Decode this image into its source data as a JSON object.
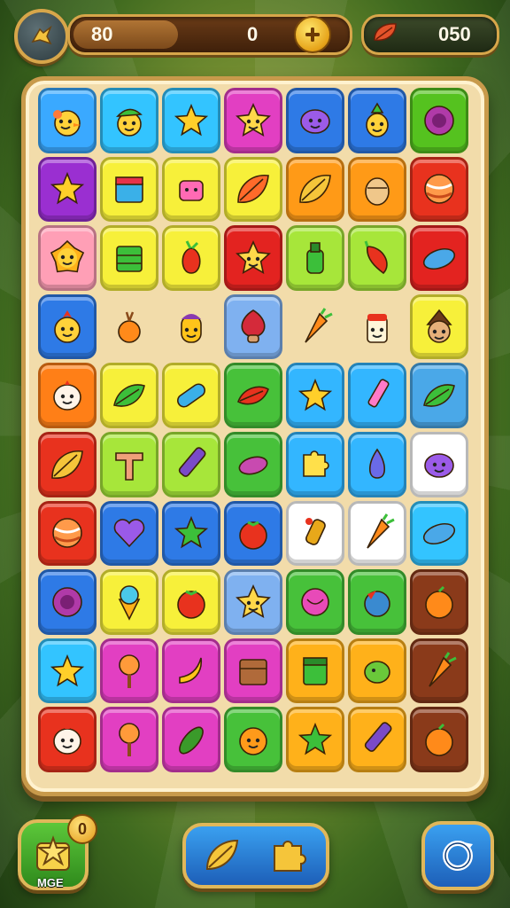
{
  "hud": {
    "moves_value": "80",
    "score_value": "0",
    "leaf_value": "050",
    "colors": {
      "accent_gold": "#d7a64a",
      "bar_brown": "#5a2e0f"
    }
  },
  "board": {
    "tiles": [
      {
        "icon": "chick-icon",
        "color": "#3aa9ff"
      },
      {
        "icon": "leaf-hat-face-icon",
        "color": "#33c4ff"
      },
      {
        "icon": "star-icon",
        "color": "#33c4ff"
      },
      {
        "icon": "smiling-star-icon",
        "color": "#e23fc2"
      },
      {
        "icon": "purple-blob-icon",
        "color": "#2e7ae6"
      },
      {
        "icon": "pineapple-face-icon",
        "color": "#2e7ae6"
      },
      {
        "icon": "purple-flower-icon",
        "color": "#55c21f"
      },
      {
        "icon": "star-icon",
        "color": "#9a2fd1"
      },
      {
        "icon": "gift-box-icon",
        "color": "#f7f03a"
      },
      {
        "icon": "pink-bag-icon",
        "color": "#f7f03a"
      },
      {
        "icon": "leaf-icon",
        "color": "#f7f03a"
      },
      {
        "icon": "gold-leaf-icon",
        "color": "#ff9a17"
      },
      {
        "icon": "acorn-icon",
        "color": "#ff9a17"
      },
      {
        "icon": "orange-ball-icon",
        "color": "#e8321e"
      },
      {
        "icon": "sun-icon",
        "color": "#ff9fb6"
      },
      {
        "icon": "green-block-icon",
        "color": "#f7f03a"
      },
      {
        "icon": "red-fruit-icon",
        "color": "#f7f03a"
      },
      {
        "icon": "smiling-star-icon",
        "color": "#e32320"
      },
      {
        "icon": "green-bottle-icon",
        "color": "#a7e63a"
      },
      {
        "icon": "chili-icon",
        "color": "#a7e63a"
      },
      {
        "icon": "blue-pill-icon",
        "color": "#e32320"
      },
      {
        "icon": "sun-face-icon",
        "color": "#2e7ae6"
      },
      {
        "icon": "onion-icon",
        "color": "#f2dcaa"
      },
      {
        "icon": "corn-face-icon",
        "color": "#f2dcaa"
      },
      {
        "icon": "red-mushroom-icon",
        "color": "#7fb1f0"
      },
      {
        "icon": "carrot-icon",
        "color": "#f2dcaa"
      },
      {
        "icon": "milk-face-icon",
        "color": "#f2dcaa"
      },
      {
        "icon": "acorn-face-icon",
        "color": "#f7f03a"
      },
      {
        "icon": "egg-face-icon",
        "color": "#ff7f17"
      },
      {
        "icon": "green-leaf-icon",
        "color": "#f7f03a"
      },
      {
        "icon": "blue-capsule-icon",
        "color": "#f7f03a"
      },
      {
        "icon": "red-leaf-icon",
        "color": "#47c13a"
      },
      {
        "icon": "star-icon",
        "color": "#33b6ff"
      },
      {
        "icon": "pink-crayon-icon",
        "color": "#33b6ff"
      },
      {
        "icon": "green-leaf-icon",
        "color": "#4aa8e8"
      },
      {
        "icon": "gold-leaf-icon",
        "color": "#e8321e"
      },
      {
        "icon": "letter-t-icon",
        "color": "#a7e63a"
      },
      {
        "icon": "crayon-icon",
        "color": "#a7e63a"
      },
      {
        "icon": "purple-bean-icon",
        "color": "#47c13a"
      },
      {
        "icon": "puzzle-icon",
        "color": "#33b6ff"
      },
      {
        "icon": "blue-drop-icon",
        "color": "#33b6ff"
      },
      {
        "icon": "purple-blob-icon",
        "color": "#ffffff"
      },
      {
        "icon": "orange-ball-icon",
        "color": "#e8321e"
      },
      {
        "icon": "heart-icon",
        "color": "#2e7ae6"
      },
      {
        "icon": "green-star-icon",
        "color": "#2e7ae6"
      },
      {
        "icon": "tomato-icon",
        "color": "#2e7ae6"
      },
      {
        "icon": "sparkler-icon",
        "color": "#ffffff"
      },
      {
        "icon": "carrot-icon",
        "color": "#ffffff"
      },
      {
        "icon": "blue-pill-icon",
        "color": "#33c4ff"
      },
      {
        "icon": "purple-flower-icon",
        "color": "#2e7ae6"
      },
      {
        "icon": "ice-cream-icon",
        "color": "#f7f03a"
      },
      {
        "icon": "tomato-icon",
        "color": "#f7f03a"
      },
      {
        "icon": "smiling-star-icon",
        "color": "#7fb1f0"
      },
      {
        "icon": "pink-ball-icon",
        "color": "#47c13a"
      },
      {
        "icon": "blue-bird-icon",
        "color": "#47c13a"
      },
      {
        "icon": "orange-fruit-icon",
        "color": "#8a3a1a"
      },
      {
        "icon": "star-icon",
        "color": "#33c4ff"
      },
      {
        "icon": "lollipop-icon",
        "color": "#e23fc2"
      },
      {
        "icon": "banana-icon",
        "color": "#e23fc2"
      },
      {
        "icon": "crate-icon",
        "color": "#e23fc2"
      },
      {
        "icon": "green-box-icon",
        "color": "#ffb11a"
      },
      {
        "icon": "green-bean-icon",
        "color": "#ffb11a"
      },
      {
        "icon": "carrot-icon",
        "color": "#8a3a1a"
      },
      {
        "icon": "egg-face-icon",
        "color": "#e8321e"
      },
      {
        "icon": "lollipop-icon",
        "color": "#e23fc2"
      },
      {
        "icon": "cucumber-icon",
        "color": "#e23fc2"
      },
      {
        "icon": "orange-face-icon",
        "color": "#47c13a"
      },
      {
        "icon": "green-star-icon",
        "color": "#ffb11a"
      },
      {
        "icon": "crayon-icon",
        "color": "#ffb11a"
      },
      {
        "icon": "orange-fruit-icon",
        "color": "#8a3a1a"
      }
    ]
  },
  "bottom": {
    "mode_label": "MGE",
    "mode_badge": "0",
    "left_icon": "star-in-box-icon",
    "center_icons": [
      "gold-leaf-icon",
      "puzzle-piece-icon"
    ],
    "right_icon": "refresh-icon"
  }
}
